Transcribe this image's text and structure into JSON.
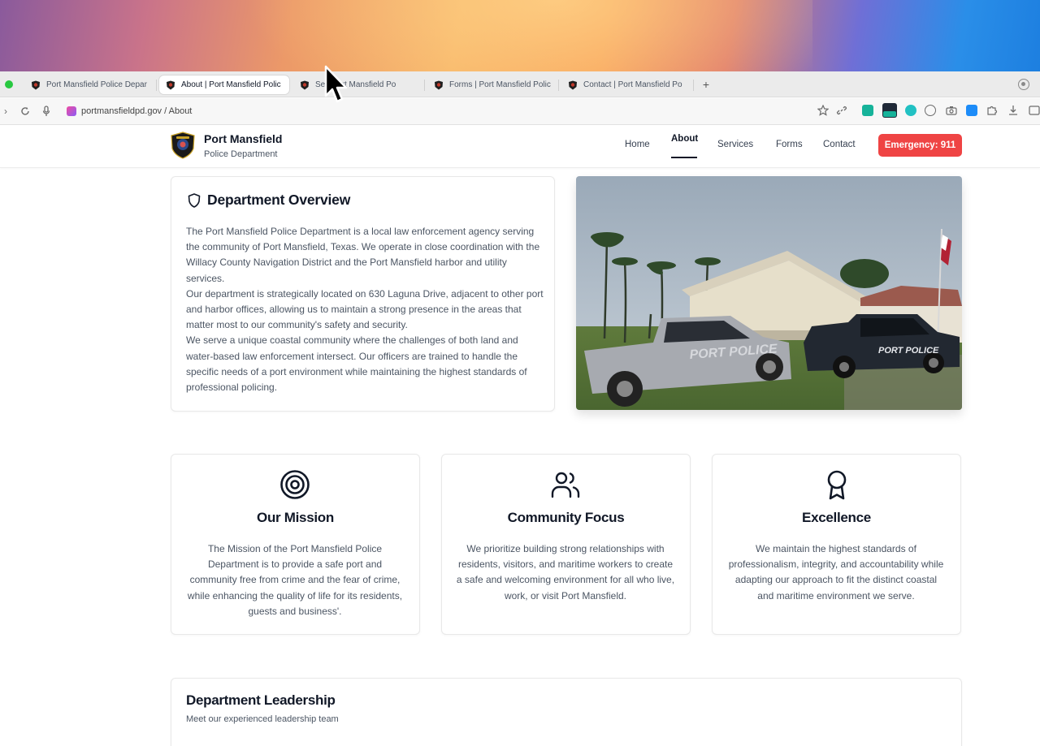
{
  "browser": {
    "tabs": [
      {
        "title": "Port Mansfield Police Depar",
        "active": false
      },
      {
        "title": "About | Port Mansfield Polic",
        "active": true
      },
      {
        "title": "Se     | Port Mansfield Po",
        "active": false
      },
      {
        "title": "Forms | Port Mansfield Polic",
        "active": false
      },
      {
        "title": "Contact | Port Mansfield Po",
        "active": false
      }
    ],
    "url": "portmansfieldpd.gov / About",
    "new_tab_label": "+"
  },
  "site": {
    "brand_name": "Port Mansfield",
    "brand_sub": "Police Department",
    "nav": [
      {
        "label": "Home",
        "active": false
      },
      {
        "label": "About",
        "active": true
      },
      {
        "label": "Services",
        "active": false
      },
      {
        "label": "Forms",
        "active": false
      },
      {
        "label": "Contact",
        "active": false
      }
    ],
    "emergency_label": "Emergency: 911",
    "accent": "#ef4444"
  },
  "overview": {
    "title": "Department Overview",
    "icon": "shield-icon",
    "paragraphs": [
      "The Port Mansfield Police Department is a local law enforcement agency serving the community of Port Mansfield, Texas. We operate in close coordination with the Willacy County Navigation District and the Port Mansfield harbor and utility services.",
      "Our department is strategically located on 630 Laguna Drive, adjacent to other port and harbor offices, allowing us to maintain a strong presence in the areas that matter most to our community's safety and security.",
      "We serve a unique coastal community where the challenges of both land and water-based law enforcement intersect. Our officers are trained to handle the specific needs of a port environment while maintaining the highest standards of professional policing."
    ],
    "photo_truck_text_1": "PORT POLICE",
    "photo_truck_text_2": "PORT POLICE"
  },
  "values": [
    {
      "icon": "target-icon",
      "title": "Our Mission",
      "text": "The Mission of the Port Mansfield Police Department is to provide a safe port and community free from crime and the fear of crime, while enhancing the quality of life for its residents, guests and business'."
    },
    {
      "icon": "users-icon",
      "title": "Community Focus",
      "text": "We prioritize building strong relationships with residents, visitors, and maritime workers to create a safe and welcoming environment for all who live, work, or visit Port Mansfield."
    },
    {
      "icon": "award-icon",
      "title": "Excellence",
      "text": "We maintain the highest standards of professionalism, integrity, and accountability while adapting our approach to fit the distinct coastal and maritime environment we serve."
    }
  ],
  "leadership": {
    "title": "Department Leadership",
    "subtitle": "Meet our experienced leadership team"
  }
}
